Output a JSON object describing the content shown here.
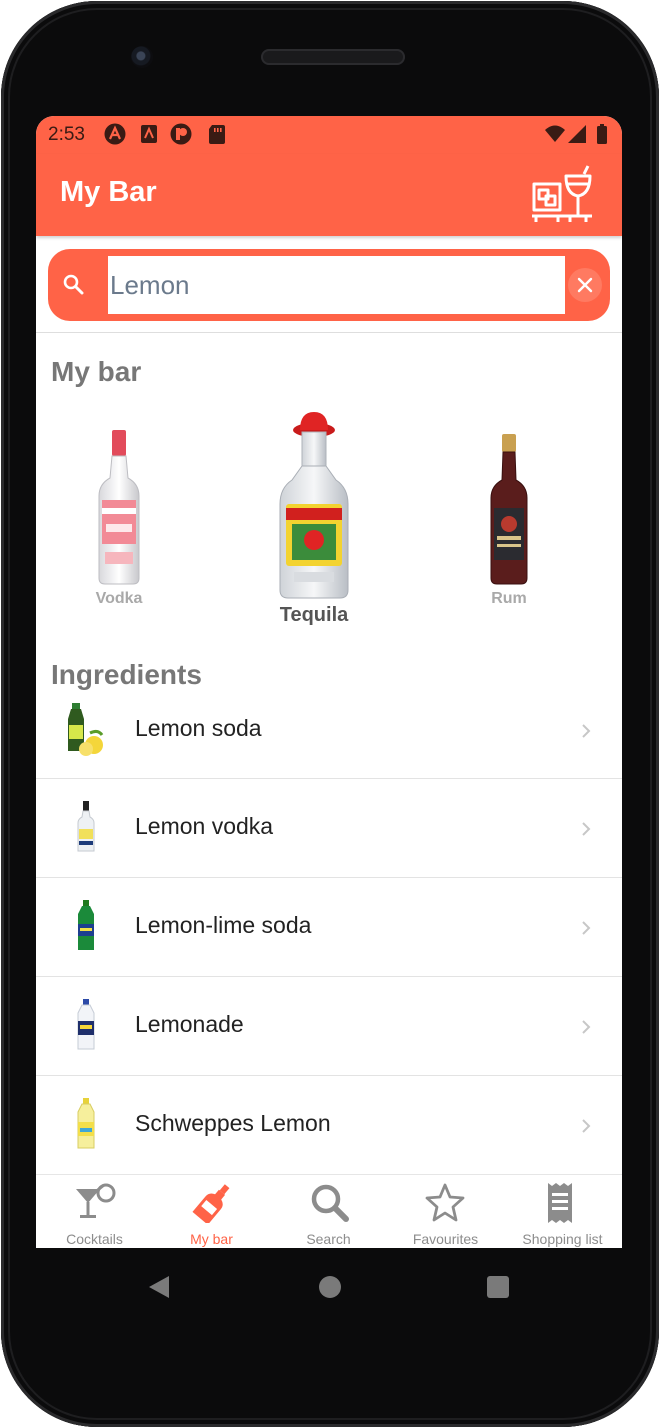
{
  "status_bar": {
    "time": "2:53"
  },
  "app_bar": {
    "title": "My Bar"
  },
  "search": {
    "value": "Lemon",
    "placeholder": "Search"
  },
  "my_bar": {
    "title": "My bar",
    "bottles": [
      {
        "name": "Vodka"
      },
      {
        "name": "Tequila"
      },
      {
        "name": "Rum"
      }
    ]
  },
  "ingredients": {
    "title": "Ingredients",
    "items": [
      {
        "name": "Lemon soda"
      },
      {
        "name": "Lemon vodka"
      },
      {
        "name": "Lemon-lime soda"
      },
      {
        "name": "Lemonade"
      },
      {
        "name": "Schweppes Lemon"
      }
    ]
  },
  "bottom_nav": {
    "tabs": [
      {
        "label": "Cocktails",
        "icon": "cocktail-icon"
      },
      {
        "label": "My bar",
        "icon": "bottle-icon",
        "active": true
      },
      {
        "label": "Search",
        "icon": "search-icon"
      },
      {
        "label": "Favourites",
        "icon": "star-icon"
      },
      {
        "label": "Shopping list",
        "icon": "receipt-icon"
      }
    ]
  },
  "colors": {
    "accent": "#ff6347",
    "inactive": "#8c8c8c"
  }
}
